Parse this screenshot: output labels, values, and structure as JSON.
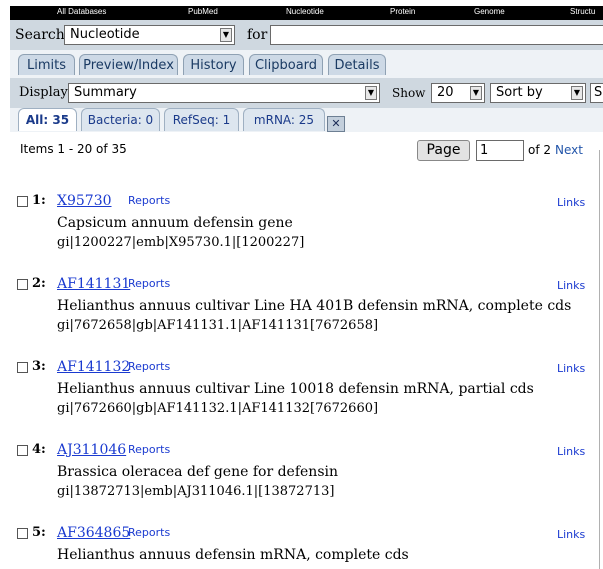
{
  "topnav": [
    "All Databases",
    "PubMed",
    "Nucleotide",
    "Protein",
    "Genome",
    "Structu"
  ],
  "search": {
    "label": "Search",
    "database": "Nucleotide",
    "for_label": "for",
    "query": ""
  },
  "tabs": [
    "Limits",
    "Preview/Index",
    "History",
    "Clipboard",
    "Details"
  ],
  "display": {
    "label": "Display",
    "value": "Summary",
    "show_label": "Show",
    "show_value": "20",
    "sort_value": "Sort by",
    "extra_value": "S"
  },
  "db_tabs": [
    {
      "label": "All: 35",
      "active": true
    },
    {
      "label": "Bacteria: 0",
      "active": false
    },
    {
      "label": "RefSeq: 1",
      "active": false
    },
    {
      "label": "mRNA: 25",
      "active": false
    }
  ],
  "paging": {
    "items": "Items 1 - 20 of 35",
    "page_button": "Page",
    "page_value": "1",
    "of_label": "of 2",
    "next_label": "Next"
  },
  "results": [
    {
      "num": "1:",
      "accession": "X95730",
      "reports": "Reports",
      "links": "Links",
      "desc": "Capsicum annuum defensin gene",
      "ident": "gi|1200227|emb|X95730.1|[1200227]"
    },
    {
      "num": "2:",
      "accession": "AF141131",
      "reports": "Reports",
      "links": "Links",
      "desc": "Helianthus annuus cultivar Line HA 401B defensin mRNA, complete cds",
      "ident": "gi|7672658|gb|AF141131.1|AF141131[7672658]"
    },
    {
      "num": "3:",
      "accession": "AF141132",
      "reports": "Reports",
      "links": "Links",
      "desc": "Helianthus annuus cultivar Line 10018 defensin mRNA, partial cds",
      "ident": "gi|7672660|gb|AF141132.1|AF141132[7672660]"
    },
    {
      "num": "4:",
      "accession": "AJ311046",
      "reports": "Reports",
      "links": "Links",
      "desc": "Brassica oleracea def gene for defensin",
      "ident": "gi|13872713|emb|AJ311046.1|[13872713]"
    },
    {
      "num": "5:",
      "accession": "AF364865",
      "reports": "Reports",
      "links": "Links",
      "desc": "Helianthus annuus defensin mRNA, complete cds",
      "ident": ""
    }
  ]
}
